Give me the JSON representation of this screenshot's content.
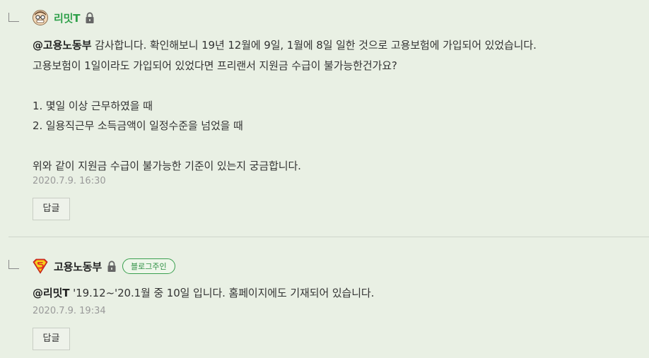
{
  "comments": [
    {
      "author": "리밋T",
      "mention": "@고용노동부",
      "line1": " 감사합니다. 확인해보니 19년 12월에 9일, 1월에 8일 일한 것으로 고용보험에 가입되어 있었습니다.",
      "lines_rest": "고용보험이 1일이라도 가입되어 있었다면 프리랜서 지원금 수급이 불가능한건가요?\n\n1. 몇일 이상 근무하였을 때\n2. 일용직근무 소득금액이 일정수준을 넘었을 때\n\n위와 같이 지원금 수급이 불가능한 기준이 있는지 궁금합니다.",
      "date": "2020.7.9. 16:30",
      "reply_label": "답글",
      "author_color": "#2fa04a",
      "icons": [
        "avatar-cartoon-glasses",
        "lock-icon",
        "reply-elbow-icon"
      ]
    },
    {
      "author": "고용노동부",
      "badge": "블로그주인",
      "mention": "@리밋T",
      "line1": " '19.12~'20.1월 중 10일 입니다. 홈페이지에도 기재되어 있습니다.",
      "date": "2020.7.9. 19:34",
      "reply_label": "답글",
      "badge_color": "#3aa04f",
      "icons": [
        "avatar-superman-shield",
        "lock-icon",
        "reply-elbow-icon"
      ]
    }
  ],
  "colors": {
    "background": "#e9f0e4",
    "date": "#999999",
    "text": "#333333"
  }
}
